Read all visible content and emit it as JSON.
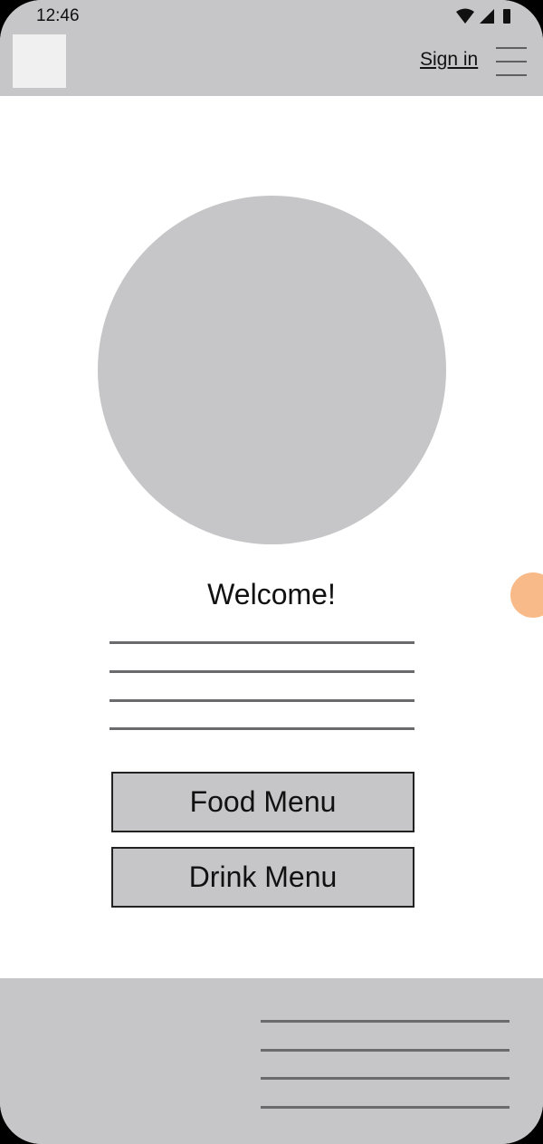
{
  "status_bar": {
    "time": "12:46",
    "icons": [
      "wifi-icon",
      "signal-icon",
      "battery-icon"
    ]
  },
  "header": {
    "logo_icon": "logo-placeholder",
    "sign_in_label": "Sign in",
    "menu_icon": "hamburger-menu-icon"
  },
  "main": {
    "hero_image": "circle-image-placeholder",
    "welcome_text": "Welcome!",
    "text_line_count": 4,
    "buttons": {
      "food_menu": "Food Menu",
      "drink_menu": "Drink Menu"
    }
  },
  "footer": {
    "link_line_count": 4
  },
  "colors": {
    "placeholder_grey": "#c6c5c7",
    "line_grey": "#6b6b6d",
    "fab_orange": "#f8b37c"
  }
}
